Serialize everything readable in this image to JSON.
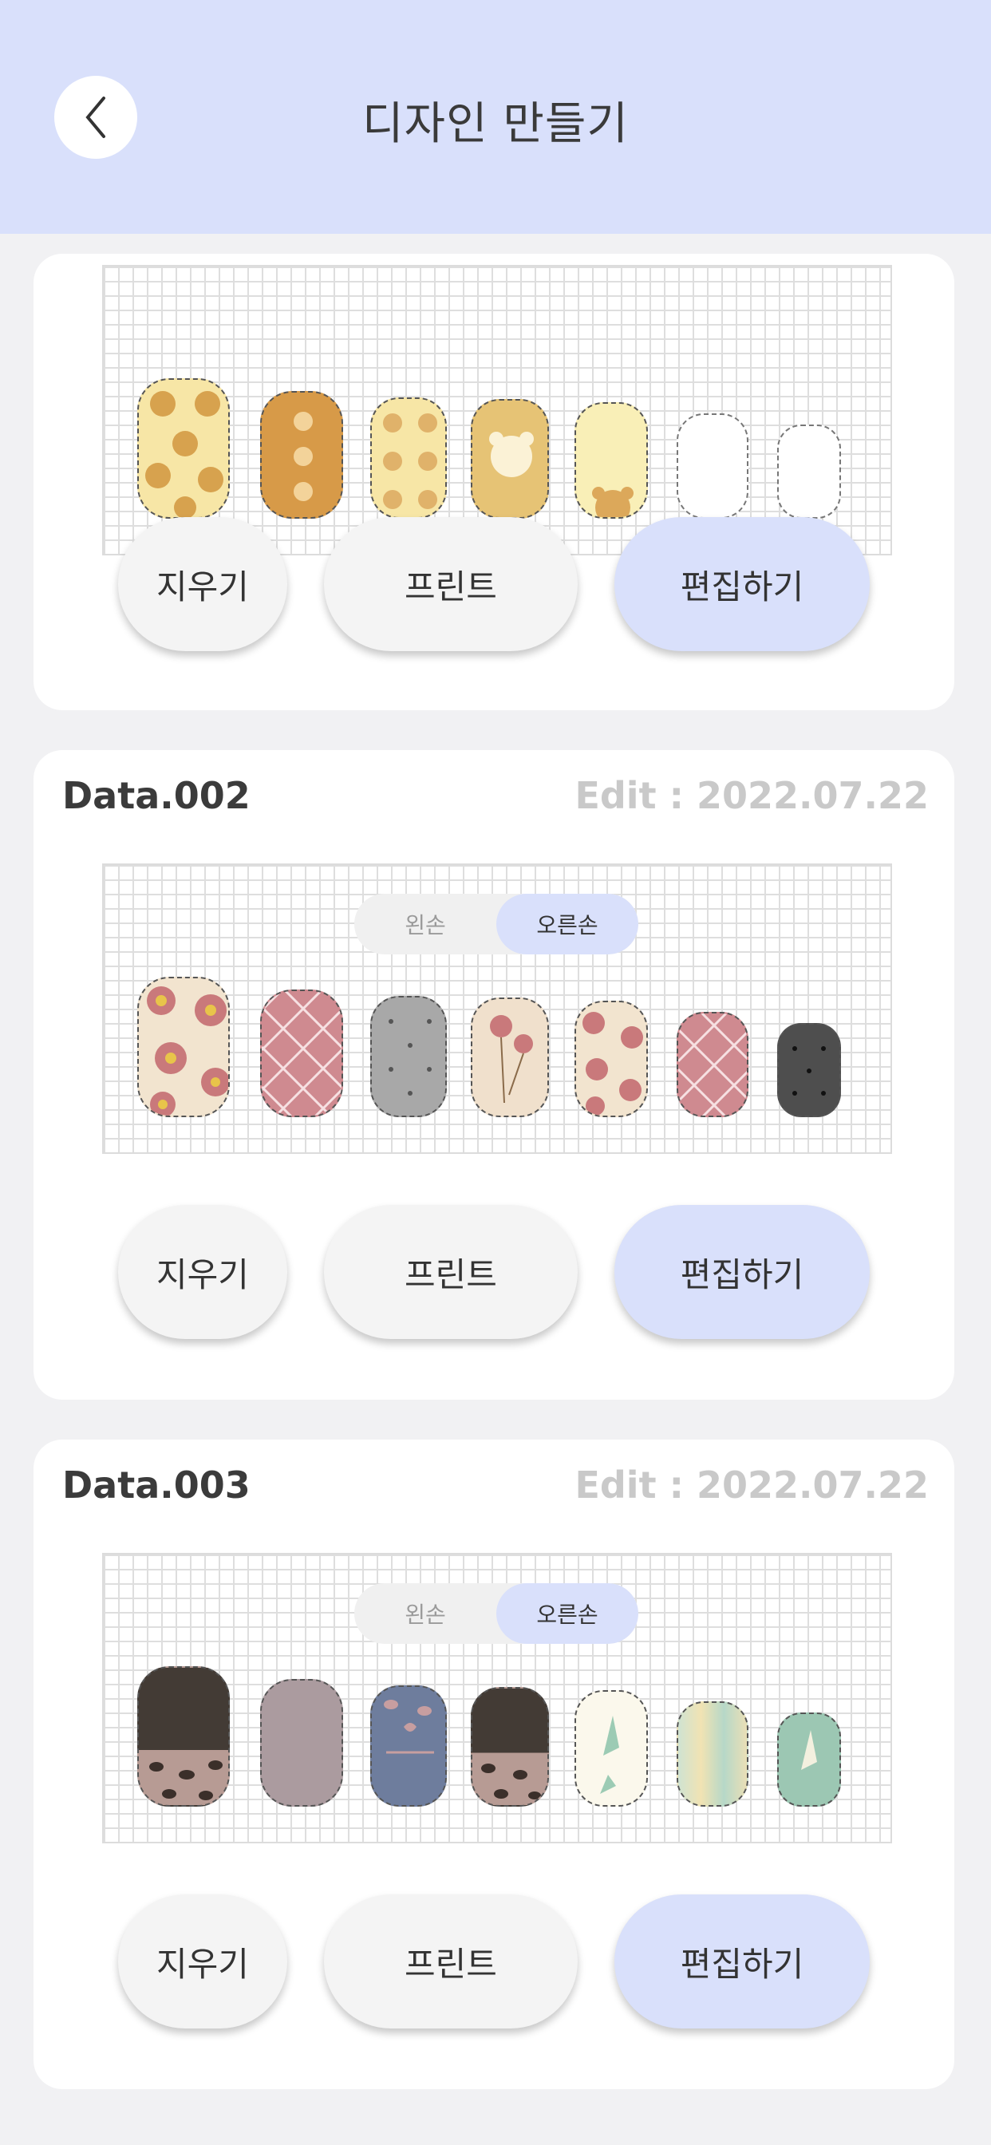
{
  "header": {
    "title": "디자인 만들기",
    "back_icon": "chevron-left-icon"
  },
  "buttons": {
    "erase": "지우기",
    "print": "프린트",
    "edit": "편집하기"
  },
  "toggle": {
    "left": "왼손",
    "right": "오른손",
    "selected": "오른손"
  },
  "cards": [
    {
      "title": "",
      "date": ""
    },
    {
      "title": "Data.002",
      "date": "Edit : 2022.07.22"
    },
    {
      "title": "Data.003",
      "date": "Edit : 2022.07.22"
    }
  ],
  "colors": {
    "accent": "#d9e0fb",
    "button_bg": "#f4f4f4",
    "page_bg": "#f1f1f3"
  }
}
